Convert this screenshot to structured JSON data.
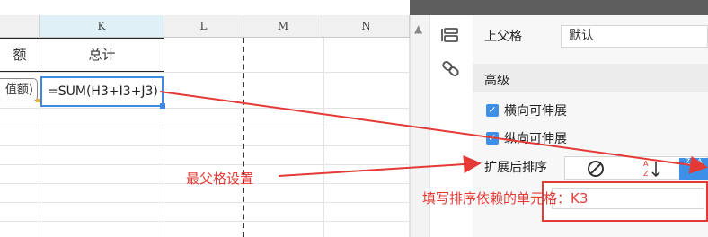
{
  "columns": [
    {
      "letter": "K",
      "selected": true
    },
    {
      "letter": "L",
      "selected": false
    },
    {
      "letter": "M",
      "selected": false
    },
    {
      "letter": "N",
      "selected": false
    }
  ],
  "sheet": {
    "header_partial": "额",
    "header_total": "总计",
    "pill_text": "值额)",
    "formula": "=SUM(H3+I3+J3)"
  },
  "panel": {
    "parent_label": "上父格",
    "parent_value": "默认",
    "advanced_label": "高级",
    "horizontal_expand": "横向可伸展",
    "vertical_expand": "纵向可伸展",
    "sort_after_expand": "扩展后排序",
    "sort_button_text": "Z↓A",
    "horizontal_checked": true,
    "vertical_checked": true
  },
  "annotations": {
    "parent_setting": "最父格设置",
    "fill_dependency": "填写排序依赖的单元格：K3",
    "color": "#e53935"
  },
  "icons": [
    "cell-properties-icon",
    "link-icon",
    "no-sort-icon",
    "sort-ascending-icon"
  ]
}
